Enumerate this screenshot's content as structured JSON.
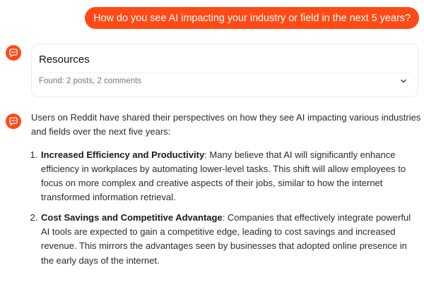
{
  "user_message": "How do you see AI impacting your industry or field in the next 5 years?",
  "resources": {
    "title": "Resources",
    "found": "Found: 2 posts, 2 comments"
  },
  "answer": {
    "intro": "Users on Reddit have shared their perspectives on how they see AI impacting various industries and fields over the next five years:",
    "items": [
      {
        "title": "Increased Efficiency and Productivity",
        "text": ": Many believe that AI will significantly enhance efficiency in workplaces by automating lower-level tasks. This shift will allow employees to focus on more complex and creative aspects of their jobs, similar to how the internet transformed information retrieval."
      },
      {
        "title": "Cost Savings and Competitive Advantage",
        "text": ": Companies that effectively integrate powerful AI tools are expected to gain a competitive edge, leading to cost savings and increased revenue. This mirrors the advantages seen by businesses that adopted online presence in the early days of the internet."
      }
    ]
  },
  "icons": {
    "assistant_avatar": "chat-bubble-icon",
    "expand": "chevron-down-icon"
  },
  "colors": {
    "accent": "#ff4a16",
    "card_border": "#ececec",
    "muted_text": "#777777"
  }
}
